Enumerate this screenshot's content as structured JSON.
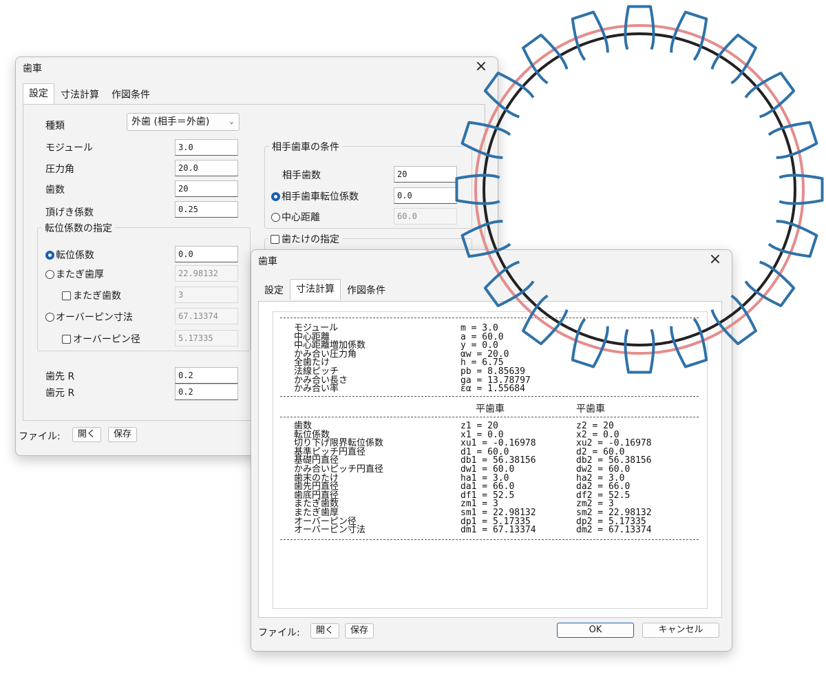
{
  "dialog1": {
    "title": "歯車",
    "close": "×",
    "tabs": [
      "設定",
      "寸法計算",
      "作図条件"
    ],
    "type_label": "種類",
    "type_value": "外歯 (相手＝外歯)",
    "module_label": "モジュール",
    "module_value": "3.0",
    "pressure_label": "圧力角",
    "pressure_value": "20.0",
    "teeth_label": "歯数",
    "teeth_value": "20",
    "clearance_label": "頂げき係数",
    "clearance_value": "0.25",
    "shift_group": "転位係数の指定",
    "shift_coef_label": "転位係数",
    "shift_coef_value": "0.0",
    "span_thick_label": "またぎ歯厚",
    "span_thick_value": "22.98132",
    "span_teeth_label": "またぎ歯数",
    "span_teeth_value": "3",
    "over_pin_label": "オーバーピン寸法",
    "over_pin_value": "67.13374",
    "pin_dia_label": "オーバーピン径",
    "pin_dia_value": "5.17335",
    "tip_r_label": "歯先 R",
    "tip_r_value": "0.2",
    "root_r_label": "歯元 R",
    "root_r_value": "0.2",
    "mate_group": "相手歯車の条件",
    "mate_teeth_label": "相手歯数",
    "mate_teeth_value": "20",
    "mate_shift_label": "相手歯車転位係数",
    "mate_shift_value": "0.0",
    "center_label": "中心距離",
    "center_value": "60.0",
    "depth_group": "歯たけの指定",
    "file_label": "ファイル:",
    "open_btn": "開く",
    "save_btn": "保存"
  },
  "dialog2": {
    "title": "歯車",
    "close": "×",
    "tabs": [
      "設定",
      "寸法計算",
      "作図条件"
    ],
    "summary_names": [
      "モジュール",
      "中心距離",
      "中心距離増加係数",
      "かみ合い圧力角",
      "全歯たけ",
      "法線ピッチ",
      "かみ合い長さ",
      "かみ合い率"
    ],
    "summary_values": [
      "m = 3.0",
      "a = 60.0",
      "y = 0.0",
      "αw = 20.0",
      "h = 6.75",
      "pb = 8.85639",
      "ga = 13.78797",
      "εα = 1.55684"
    ],
    "col_header_1": "平歯車",
    "col_header_2": "平歯車",
    "detail_names": [
      "歯数",
      "転位係数",
      "切り下げ限界転位係数",
      "基準ピッチ円直径",
      "基礎円直径",
      "かみ合いピッチ円直径",
      "歯末のたけ",
      "歯先円直径",
      "歯底円直径",
      "またぎ歯数",
      "またぎ歯厚",
      "オーバーピン径",
      "オーバーピン寸法"
    ],
    "detail_col1": [
      "z1 = 20",
      "x1 = 0.0",
      "xu1 = -0.16978",
      "d1 = 60.0",
      "db1 = 56.38156",
      "dw1 = 60.0",
      "ha1 = 3.0",
      "da1 = 66.0",
      "df1 = 52.5",
      "zm1 = 3",
      "sm1 = 22.98132",
      "dp1 = 5.17335",
      "dm1 = 67.13374"
    ],
    "detail_col2": [
      "z2 = 20",
      "x2 = 0.0",
      "xu2 = -0.16978",
      "d2 = 60.0",
      "db2 = 56.38156",
      "dw2 = 60.0",
      "ha2 = 3.0",
      "da2 = 66.0",
      "df2 = 52.5",
      "zm2 = 3",
      "sm2 = 22.98132",
      "dp2 = 5.17335",
      "dm2 = 67.13374"
    ],
    "file_label": "ファイル:",
    "open_btn": "開く",
    "save_btn": "保存",
    "ok_btn": "OK",
    "cancel_btn": "キャンセル"
  },
  "gear": {
    "teeth": 20,
    "tooth_color": "#2f72a8",
    "tip_circle_color": "#e58c8c",
    "pitch_circle_color": "#222222"
  }
}
